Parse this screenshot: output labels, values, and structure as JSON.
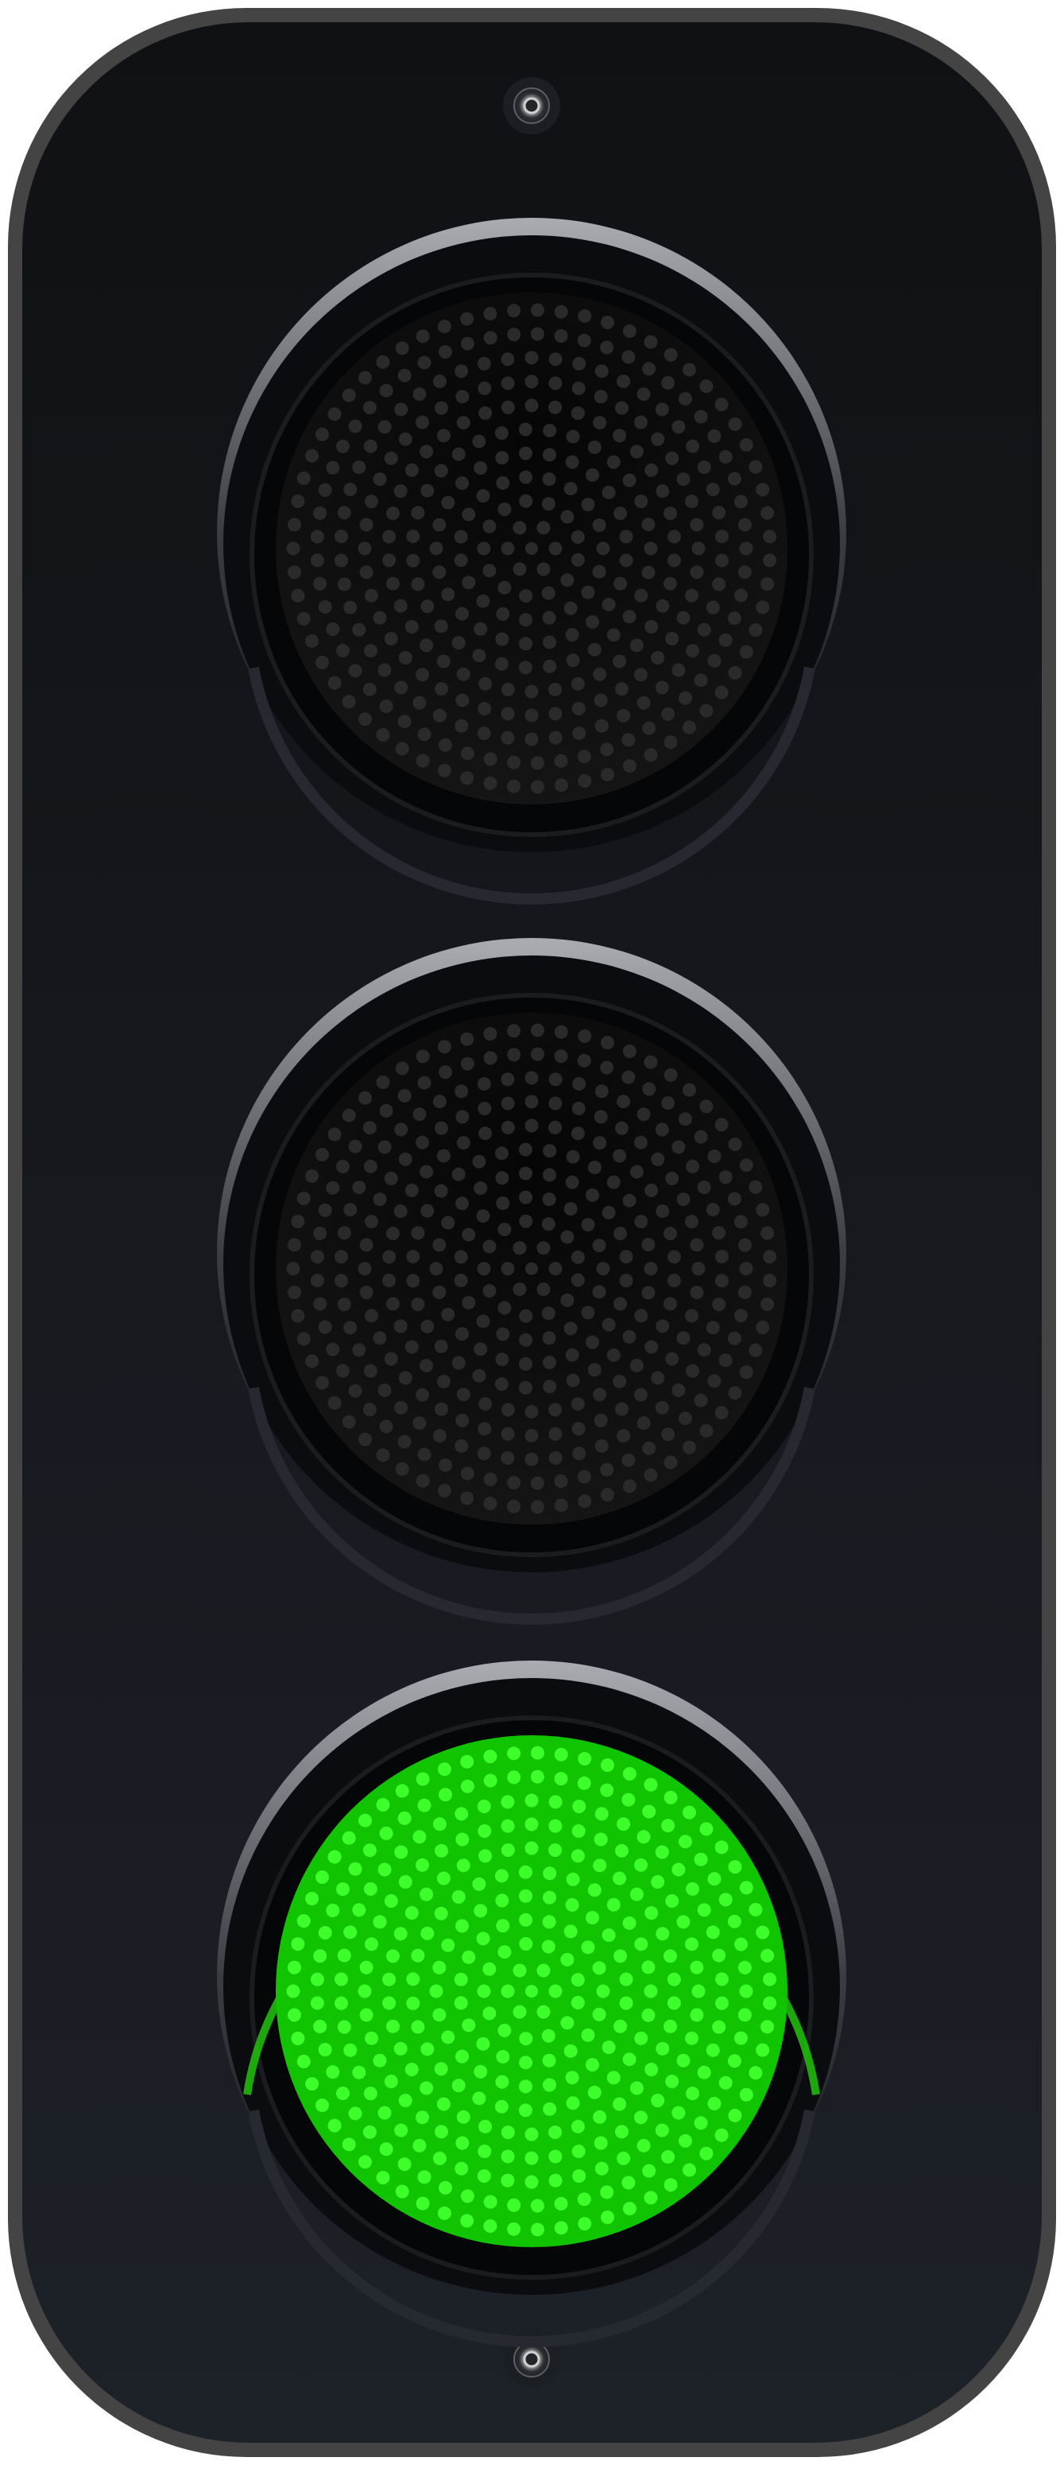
{
  "traffic_light": {
    "state": "green",
    "lamps": [
      {
        "position": "top",
        "color_name": "red",
        "lit": false,
        "off_dot_color": "#2a2a2a"
      },
      {
        "position": "middle",
        "color_name": "yellow",
        "lit": false,
        "off_dot_color": "#2a2a2a"
      },
      {
        "position": "bottom",
        "color_name": "green",
        "lit": true,
        "lit_color": "#11c400",
        "lit_dot_color": "#3dff2a",
        "glow_color": "#22c40e"
      }
    ],
    "colors": {
      "frame_border": "#444444",
      "housing_top": "#0f1114",
      "housing_bottom": "#1d2128",
      "visor_highlight": "#a9acb1",
      "screw": "#bfbfbf"
    },
    "icons": [
      "top-screw-icon",
      "bottom-screw-icon"
    ]
  }
}
